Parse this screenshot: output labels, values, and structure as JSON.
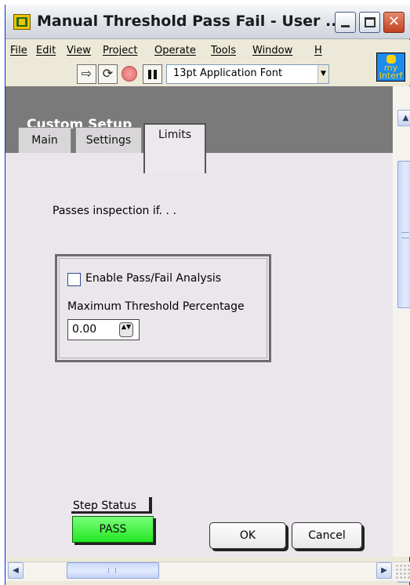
{
  "window": {
    "title": "Manual Threshold Pass Fail - User ...",
    "icons": {
      "app": "labview-vi-icon",
      "vi": "my-interface-vi-icon"
    },
    "controls": {
      "minimize": "minimize-icon",
      "maximize": "maximize-icon",
      "close": "close-icon",
      "close_symbol": "✕"
    }
  },
  "menubar": {
    "items": [
      {
        "label": "File"
      },
      {
        "label": "Edit"
      },
      {
        "label": "View"
      },
      {
        "label": "Project"
      },
      {
        "label": "Operate"
      },
      {
        "label": "Tools"
      },
      {
        "label": "Window"
      },
      {
        "label": "H"
      }
    ]
  },
  "toolbar": {
    "run_symbol": "⇨",
    "run_continuous_symbol": "⟳",
    "font_ring_value": "13pt Application Font",
    "dropdown_symbol": "▼",
    "vi_icon_text": "my Interf"
  },
  "panel": {
    "header_title": "Custom Setup",
    "tabs": [
      {
        "label": "Main"
      },
      {
        "label": "Settings"
      },
      {
        "label": "Limits"
      }
    ],
    "active_tab": "Limits",
    "limits": {
      "intro": "Passes inspection if. . .",
      "enable_checkbox_label": "Enable Pass/Fail Analysis",
      "enable_checked": false,
      "threshold_label": "Maximum Threshold Percentage",
      "threshold_value": "0.00",
      "spin_symbol": "▲▼"
    },
    "step_status_label": "Step Status",
    "step_status_value": "PASS",
    "step_status_color": "#22e622",
    "ok_label": "OK",
    "cancel_label": "Cancel"
  },
  "scrollbars": {
    "up": "▲",
    "down": "▼",
    "left": "◀",
    "right": "▶"
  }
}
